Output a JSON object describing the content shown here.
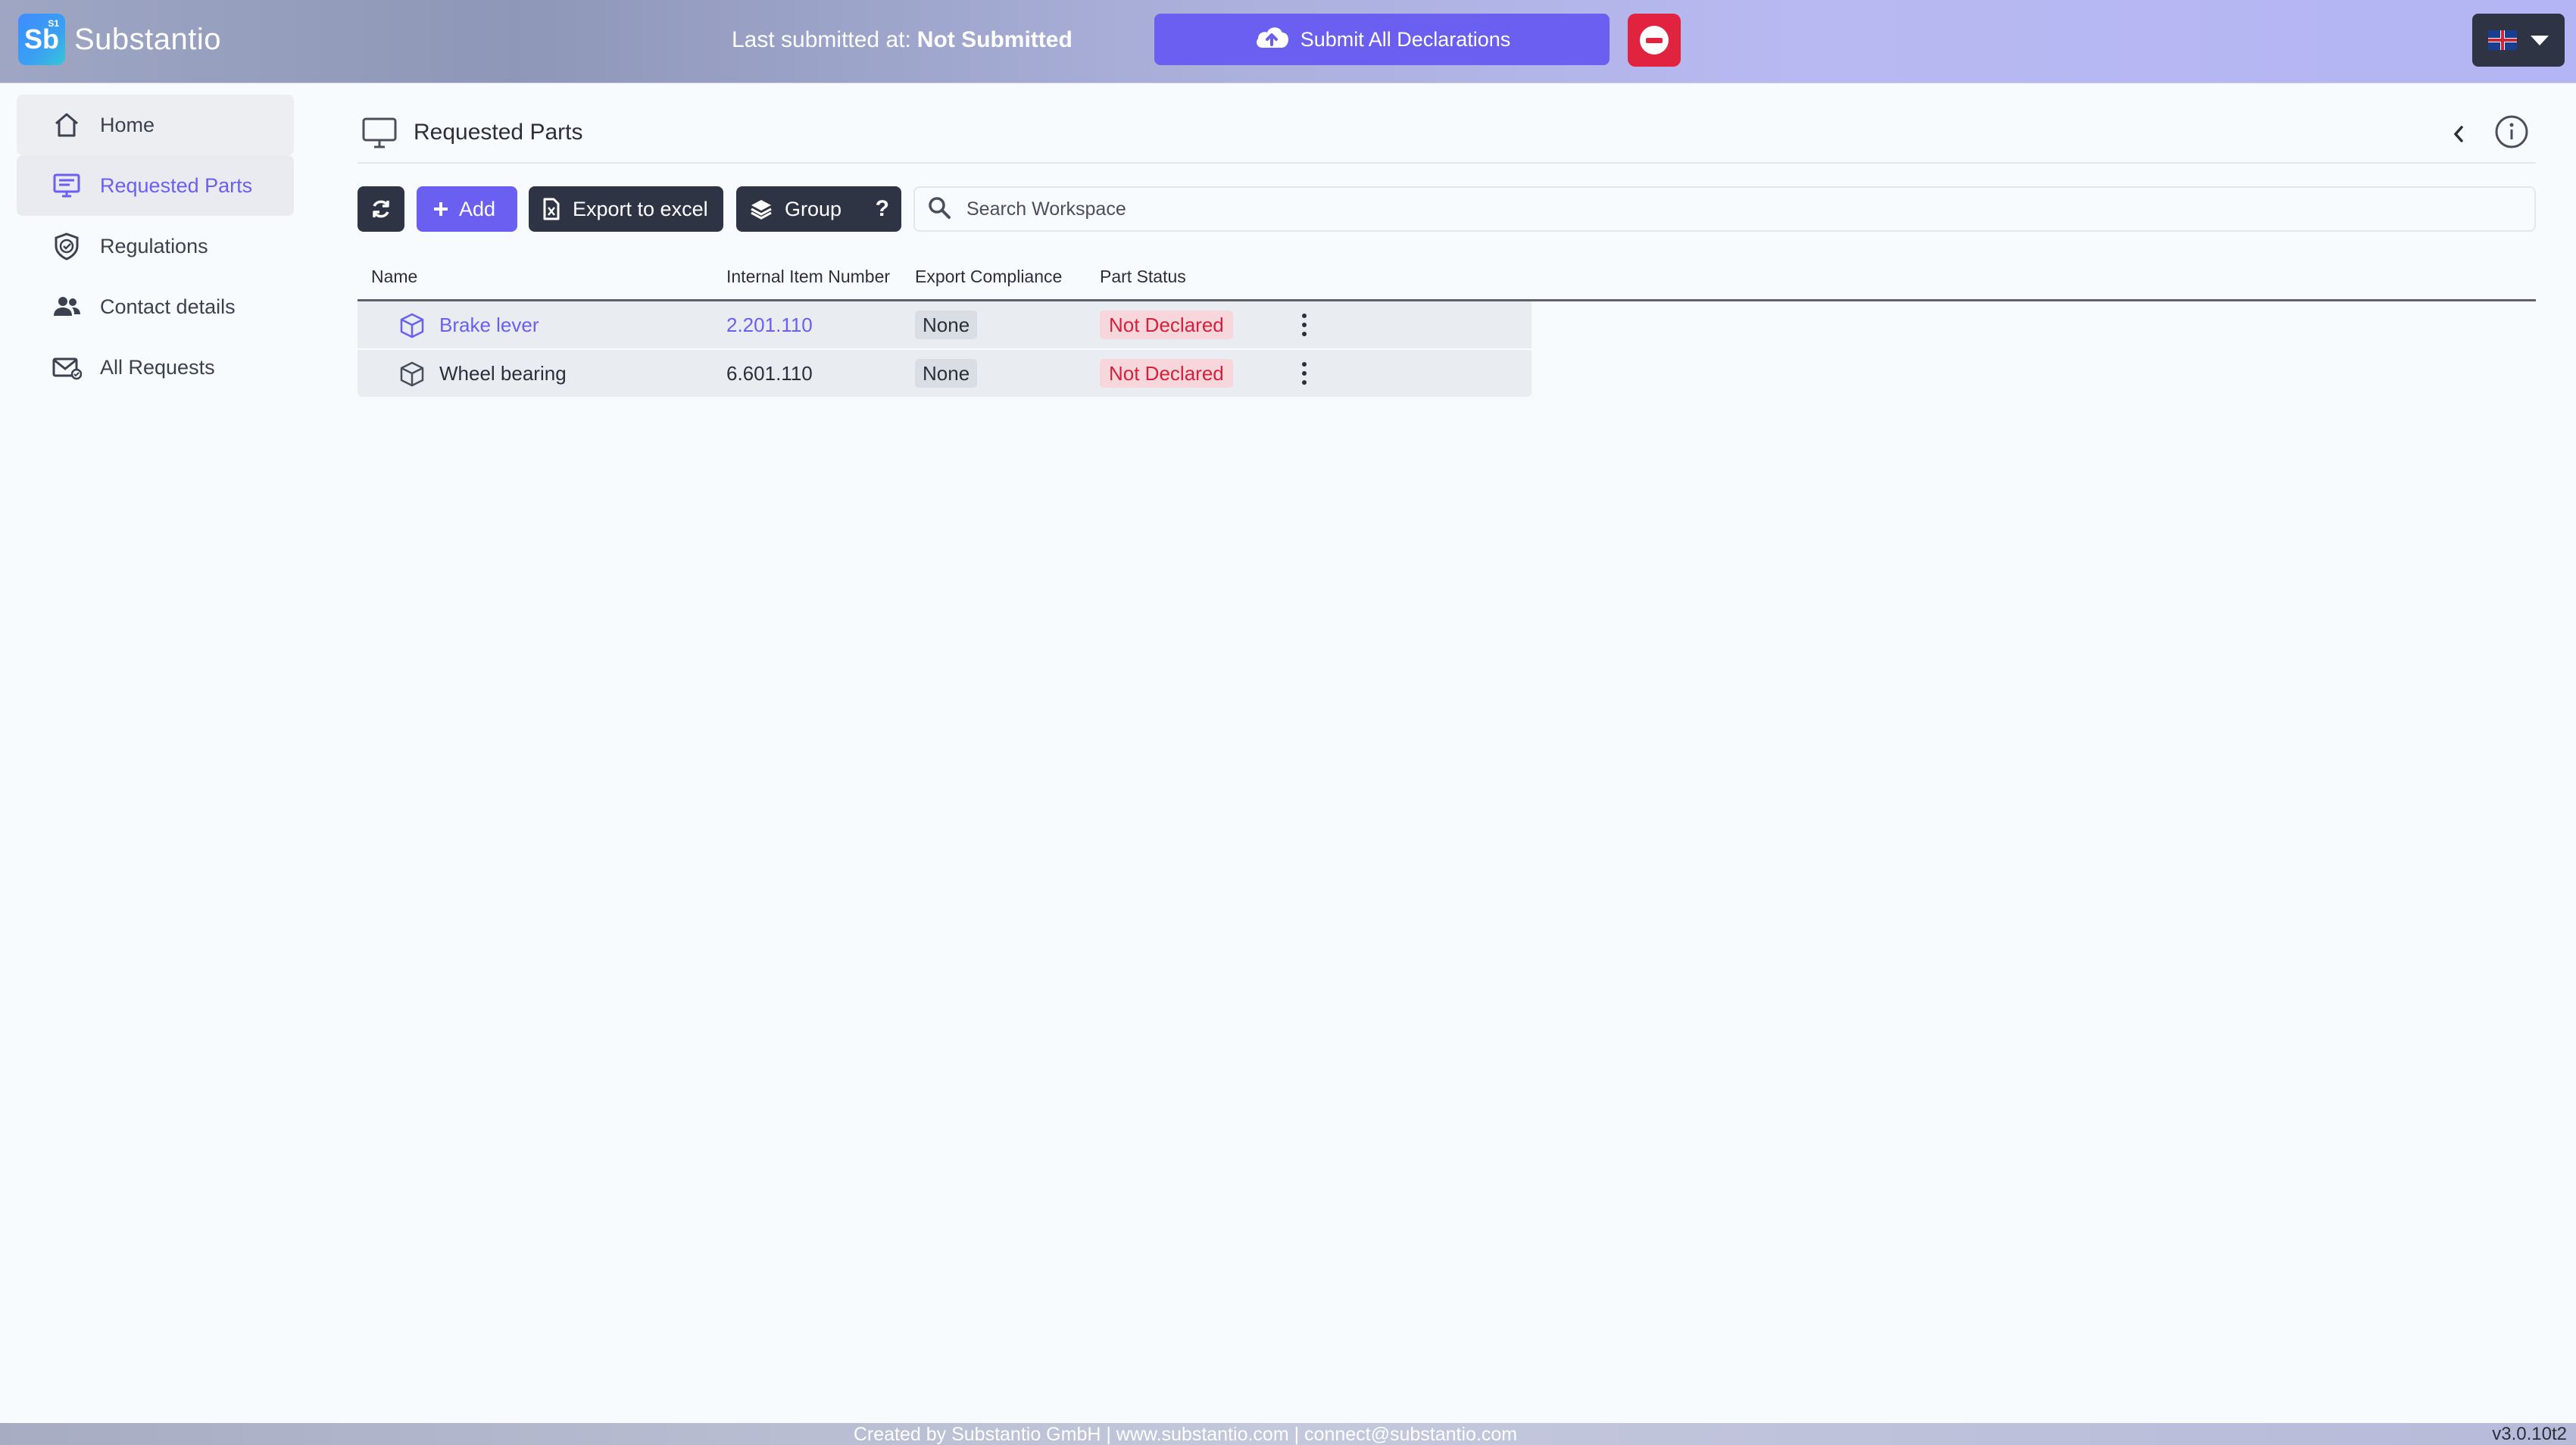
{
  "app": {
    "logo_text": "Sb",
    "logo_sup": "S1",
    "title": "Substantio"
  },
  "topbar": {
    "last_submitted_label": "Last submitted at:",
    "last_submitted_value": "Not Submitted",
    "submit_button": "Submit All Declarations"
  },
  "sidebar": {
    "items": [
      {
        "label": "Home",
        "icon": "home-icon"
      },
      {
        "label": "Requested Parts",
        "icon": "monitor-list-icon",
        "active": true
      },
      {
        "label": "Regulations",
        "icon": "shield-check-icon"
      },
      {
        "label": "Contact details",
        "icon": "users-icon"
      },
      {
        "label": "All Requests",
        "icon": "mail-icon"
      }
    ]
  },
  "main": {
    "page_title": "Requested Parts",
    "toolbar": {
      "add_label": "Add",
      "export_label": "Export to excel",
      "group_label": "Group",
      "help_label": "?",
      "search_placeholder": "Search Workspace"
    },
    "table": {
      "columns": [
        "Name",
        "Internal Item Number",
        "Export Compliance",
        "Part Status"
      ],
      "rows": [
        {
          "name": "Brake lever",
          "item_number": "2.201.110",
          "export_compliance": "None",
          "part_status": "Not Declared",
          "highlighted": true
        },
        {
          "name": "Wheel bearing",
          "item_number": "6.601.110",
          "export_compliance": "None",
          "part_status": "Not Declared",
          "highlighted": false
        }
      ]
    }
  },
  "footer": {
    "credit": "Created by Substantio GmbH | www.substantio.com | connect@substantio.com",
    "version": "v3.0.10t2"
  },
  "colors": {
    "accent": "#6b5ff2",
    "danger": "#e2233f",
    "dark_button": "#2f3445",
    "status_text": "#d3213c",
    "status_bg": "#f7d6dc"
  }
}
